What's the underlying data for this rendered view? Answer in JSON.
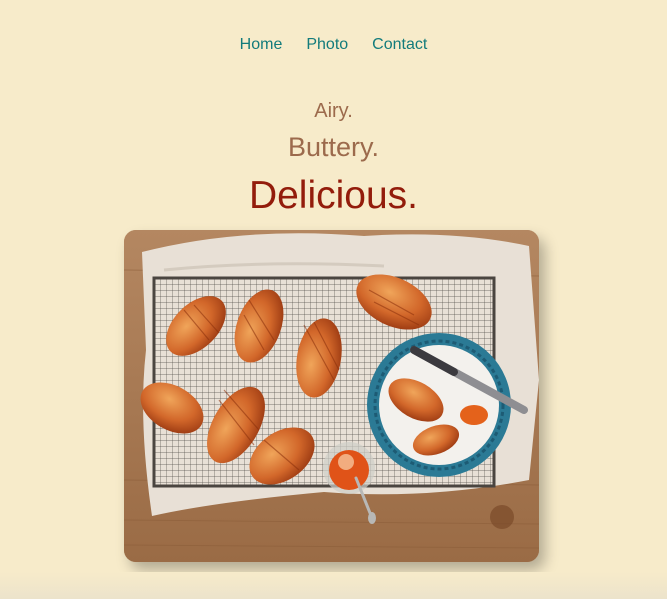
{
  "nav": {
    "items": [
      {
        "label": "Home"
      },
      {
        "label": "Photo"
      },
      {
        "label": "Contact"
      }
    ]
  },
  "tagline": {
    "line1": "Airy.",
    "line2": "Buttery.",
    "line3": "Delicious."
  },
  "colors": {
    "background": "#f7ebca",
    "nav_link": "#127b7b",
    "tagline_soft": "#9c6a4c",
    "tagline_strong": "#931c0b"
  }
}
